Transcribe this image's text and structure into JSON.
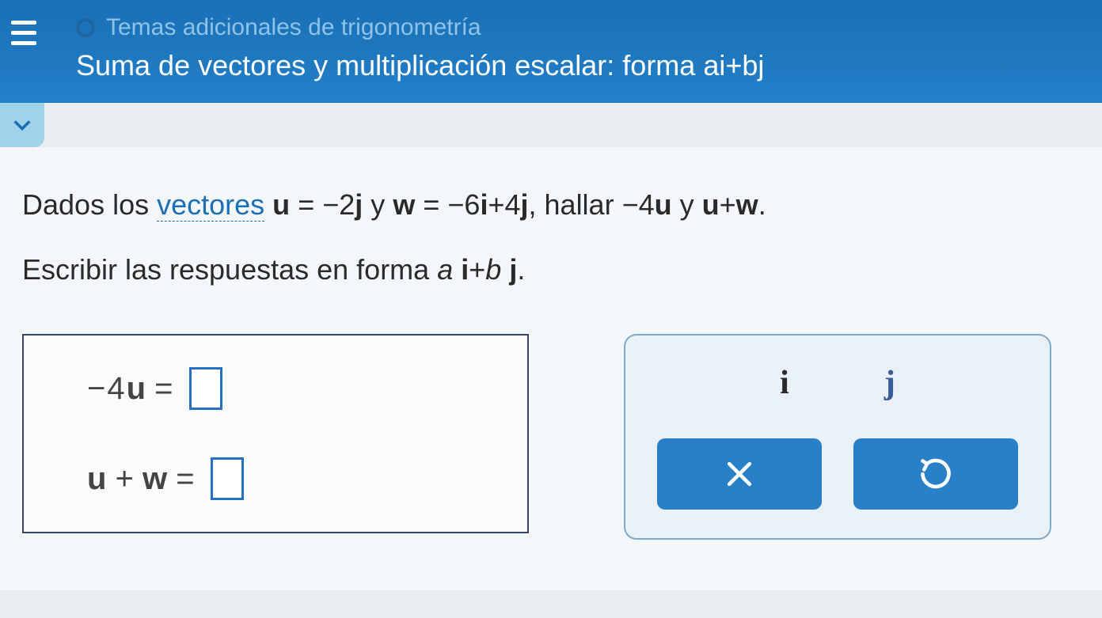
{
  "header": {
    "breadcrumb": "Temas adicionales de trigonometría",
    "title": "Suma de vectores y multiplicación escalar: forma ai+bj"
  },
  "question": {
    "prefix": "Dados los ",
    "link_text": "vectores",
    "u_def_lhs": "u",
    "eq": "=",
    "u_def_rhs_num": "−2",
    "u_def_rhs_vec": "j",
    "and": " y ",
    "w_lhs": "w",
    "w_rhs_a": "−6",
    "w_rhs_i": "i",
    "w_rhs_plus": "+4",
    "w_rhs_j": "j",
    "find": ", hallar ",
    "expr1_num": "−4",
    "expr1_vec": "u",
    "and2": " y ",
    "expr2_u": "u",
    "expr2_plus": "+",
    "expr2_w": "w",
    "period": "."
  },
  "instruction": {
    "text_before": "Escribir las respuestas en forma ",
    "a": "a",
    "i": "i",
    "plus": "+",
    "b": "b",
    "j": "j",
    "period": "."
  },
  "answers": {
    "line1_lhs_num": "−4",
    "line1_lhs_vec": "u",
    "eq": "=",
    "line2_u": "u",
    "line2_plus": " + ",
    "line2_w": "w"
  },
  "keypad": {
    "i": "i",
    "j": "j"
  }
}
